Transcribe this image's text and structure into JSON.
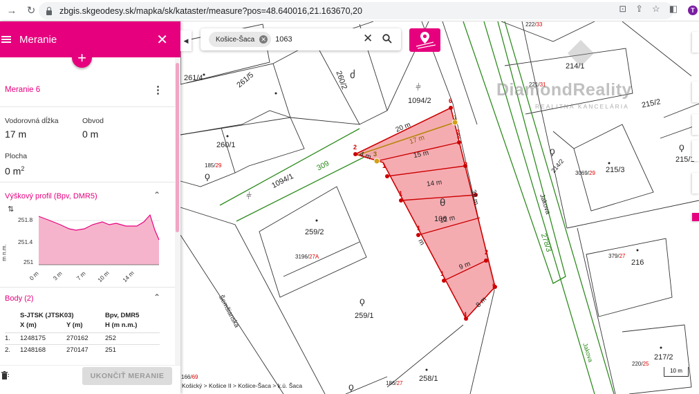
{
  "browser": {
    "url": "zbgis.skgeodesy.sk/mapka/sk/kataster/measure?pos=48.640016,21.163670,20",
    "profile_initial": "T"
  },
  "panel": {
    "title": "Meranie",
    "add_label": "+",
    "measurement_name": "Meranie 6",
    "horizontal_length_label": "Vodorovná dĺžka",
    "horizontal_length_value": "17 m",
    "perimeter_label": "Obvod",
    "perimeter_value": "0 m",
    "area_label": "Plocha",
    "area_value": "0 m",
    "area_unit_sup": "2",
    "profile_title": "Výškový profil (Bpv, DMR5)",
    "points_title": "Body (2)",
    "end_button": "UKONČIŤ MERANIE"
  },
  "profile_chart": {
    "ylabel": "m n.m.",
    "y_ticks": [
      "251.8",
      "251.4",
      "251"
    ],
    "x_ticks": [
      "0 m",
      "3 m",
      "7 m",
      "10 m",
      "14 m"
    ]
  },
  "points_table": {
    "headers_top": [
      "S-JTSK (JTSK03)",
      "Bpv, DMR5"
    ],
    "headers_sub": [
      "X (m)",
      "Y (m)",
      "H (m n.m.)"
    ],
    "rows": [
      {
        "n": "1.",
        "x": "1248175",
        "y": "270162",
        "h": "252"
      },
      {
        "n": "2.",
        "x": "1248168",
        "y": "270147",
        "h": "251"
      }
    ]
  },
  "search": {
    "chip": "Košice-Šaca",
    "query": "1063"
  },
  "breadcrumb": "Košický > Košice II > Košice-Šaca > k.ú. Šaca",
  "scale_label": "10 m",
  "watermark": {
    "brand": "DiamondReality",
    "sub": "REALITNÁ KANCELÁRIA"
  },
  "map": {
    "parcels": [
      "261/4",
      "261/5",
      "260/2",
      "1094/2",
      "260/1",
      "1094/1",
      "309",
      "259/2",
      "259/1",
      "258/1",
      "106",
      "214/1",
      "215/2",
      "214/2",
      "215/3",
      "215/1",
      "216",
      "217/2",
      "278/3"
    ],
    "parcel_tags": [
      {
        "num": "222/",
        "red": "33"
      },
      {
        "num": "221/",
        "red": "31"
      },
      {
        "num": "185/",
        "red": "29"
      },
      {
        "num": "3069/",
        "red": "29"
      },
      {
        "num": "3196/",
        "red": "27A"
      },
      {
        "num": "379/",
        "red": "27"
      },
      {
        "num": "220/",
        "red": "25"
      },
      {
        "num": "186/",
        "red": "27"
      },
      {
        "num": "166/",
        "red": "69"
      }
    ],
    "streets": [
      "Jakova",
      "Šemšianska",
      "Jakova"
    ],
    "segments": [
      "20 m",
      "17 m",
      "15 m",
      "14 m",
      "12 m",
      "9 m",
      "8 m",
      "4 m",
      "36 m",
      "m"
    ],
    "vertex_numbers": [
      "2",
      "2",
      "1",
      "1",
      "2",
      "1",
      "1",
      "2",
      "5",
      "4",
      "2",
      "3",
      "1",
      "6"
    ],
    "accent": "#e6007e",
    "polygon_fill": "#f4a3a8",
    "polygon_stroke": "#cc0000",
    "street_line": "#2e8b1e"
  }
}
